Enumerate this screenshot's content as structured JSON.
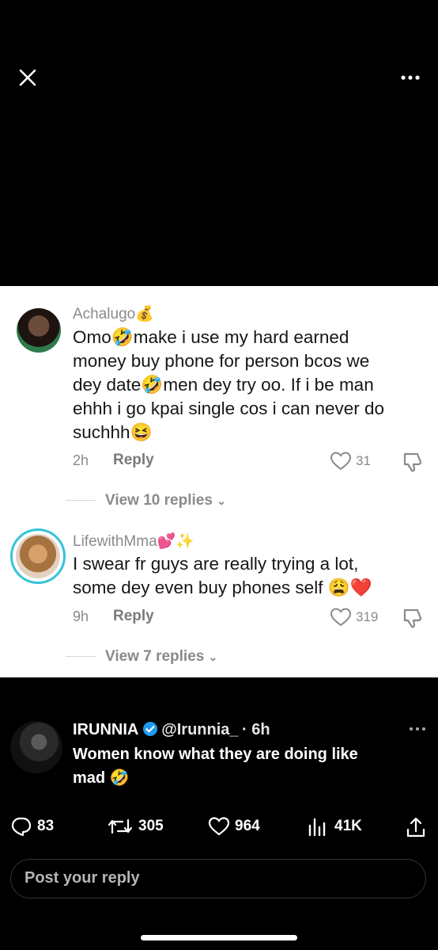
{
  "top_bar": {
    "close_icon": "close-icon",
    "more_icon": "more-horizontal-icon"
  },
  "comments": [
    {
      "username": "Achalugo💰",
      "lines": [
        "Omo🤣make i use my hard earned",
        "money buy phone for person bcos we",
        "dey date🤣men dey try oo. If i be man",
        "ehhh i go kpai single cos i can never do",
        "suchhh😆"
      ],
      "time": "2h",
      "reply_label": "Reply",
      "likes": "31",
      "view_replies": "View 10 replies"
    },
    {
      "username": "LifewithMma💕✨",
      "lines": [
        "I swear fr guys are really trying a lot,",
        "some dey even buy phones self 😩❤️"
      ],
      "time": "9h",
      "reply_label": "Reply",
      "likes": "319",
      "view_replies": "View 7 replies"
    }
  ],
  "tweet": {
    "name": "IRUNNIA",
    "handle": "@Irunnia_",
    "time": "· 6h",
    "lines": [
      "Women know what they are doing like",
      "mad 🤣"
    ],
    "stats": {
      "replies": "83",
      "retweets": "305",
      "likes": "964",
      "views": "41K"
    }
  },
  "reply_box": {
    "placeholder": "Post your reply"
  },
  "colors": {
    "verified": "#1d9bf0",
    "ring": "#36c3d8"
  }
}
